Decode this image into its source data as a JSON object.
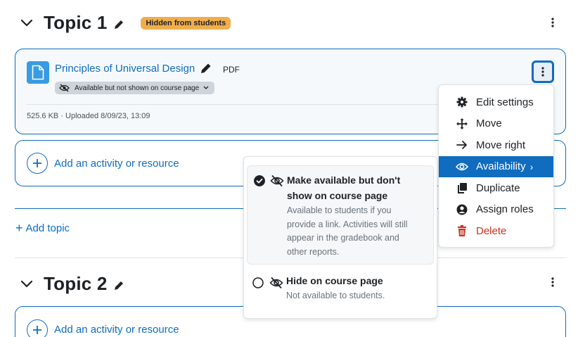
{
  "topic1": {
    "title": "Topic 1",
    "badge": "Hidden from students"
  },
  "activity": {
    "name": "Principles of Universal Design",
    "type": "PDF",
    "availability": "Available but not shown on course page",
    "meta": "525.6 KB · Uploaded 8/09/23, 13:09"
  },
  "add_activity": {
    "label": "Add an activity or resource"
  },
  "add_topic": {
    "label": "Add topic"
  },
  "topic2": {
    "title": "Topic 2"
  },
  "action_menu": {
    "items": [
      {
        "label": "Edit settings",
        "icon": "gear-icon"
      },
      {
        "label": "Move",
        "icon": "move-arrows-icon"
      },
      {
        "label": "Move right",
        "icon": "arrow-right-icon"
      },
      {
        "label": "Availability",
        "icon": "eye-icon",
        "active": true
      },
      {
        "label": "Duplicate",
        "icon": "copy-icon"
      },
      {
        "label": "Assign roles",
        "icon": "user-icon"
      },
      {
        "label": "Delete",
        "icon": "trash-icon"
      }
    ]
  },
  "availability_menu": {
    "options": [
      {
        "title_line1": "Make available but don't",
        "title_line2": "show on course page",
        "desc": [
          "Available to students if you",
          "provide a link. Activities will still",
          "appear in the gradebook and",
          "other reports."
        ],
        "selected": true,
        "icon": "eye-slash-icon"
      },
      {
        "title_line1": "Hide on course page",
        "desc": [
          "Not available to students."
        ],
        "selected": false,
        "icon": "eye-slash-icon"
      }
    ]
  },
  "colors": {
    "accent": "#0f6cbf",
    "badge": "#f0ad4e",
    "danger": "#ca3120",
    "file_icon": "#399be2"
  }
}
